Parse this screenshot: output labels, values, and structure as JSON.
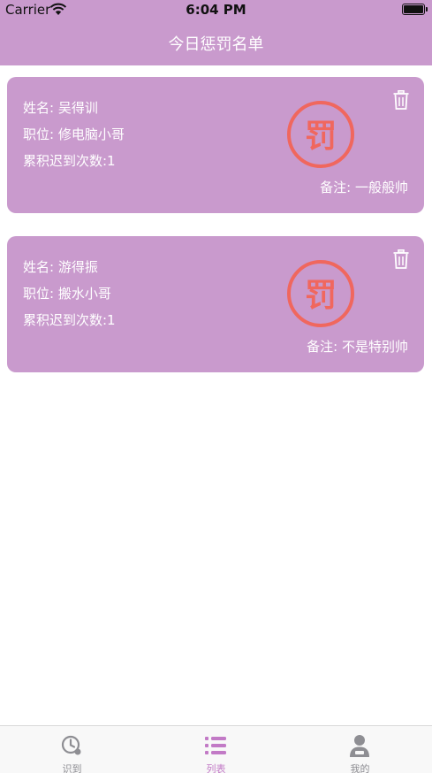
{
  "status_bar": {
    "carrier": "Carrier",
    "time": "6:04 PM"
  },
  "nav": {
    "title": "今日惩罚名单"
  },
  "cards": [
    {
      "name": "姓名: 吴得训",
      "position": "职位: 修电脑小哥",
      "late_count": "累积迟到次数:1",
      "note": "备注: 一般般帅",
      "stamp": "罚"
    },
    {
      "name": "姓名: 游得振",
      "position": "职位: 搬水小哥",
      "late_count": "累积迟到次数:1",
      "note": "备注: 不是特别帅",
      "stamp": "罚"
    }
  ],
  "tabs": [
    {
      "label": "识到",
      "icon": "clock-icon"
    },
    {
      "label": "列表",
      "icon": "list-icon",
      "active": true
    },
    {
      "label": "我的",
      "icon": "person-icon"
    }
  ],
  "colors": {
    "accent": "#c99acd",
    "stamp": "#f0675e",
    "tab_active": "#c27ac6",
    "tab_inactive": "#8e8e93"
  }
}
